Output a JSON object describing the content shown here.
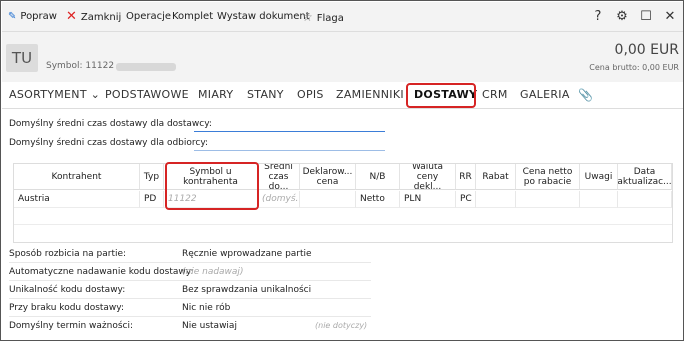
{
  "toolbar": {
    "popraw": "Popraw",
    "zamknij": "Zamknij",
    "operacje": "Operacje",
    "komplet": "Komplet",
    "wystaw": "Wystaw dokument",
    "flaga": "Flaga",
    "help": "?",
    "settings": "⚙",
    "minimize": "☐",
    "close": "✕"
  },
  "header": {
    "avatar": "TU",
    "symbol": "Symbol: 11122",
    "total": "0,00 EUR",
    "brutto": "Cena brutto: 0,00 EUR"
  },
  "tabs": [
    "ASORTYMENT ⌄",
    "PODSTAWOWE",
    "MIARY",
    "STANY",
    "OPIS",
    "ZAMIENNIKI",
    "DOSTAWY",
    "CRM",
    "GALERIA"
  ],
  "fields": {
    "avg_supplier_label": "Domyślny średni czas dostawy dla dostawcy:",
    "avg_recipient_label": "Domyślny średni czas dostawy dla odbiorcy:",
    "avg_supplier_value": "",
    "avg_recipient_value": ""
  },
  "grid": {
    "headers": [
      "Kontrahent",
      "Typ",
      "Symbol u kontrahenta",
      "Średni czas do...",
      "Deklarow... cena",
      "N/B",
      "Waluta ceny dekl...",
      "RR",
      "Rabat",
      "Cena netto po rabacie",
      "Uwagi",
      "Data aktualizac..."
    ],
    "row": [
      "Austria",
      "PD",
      "11122",
      "(domyś...",
      "",
      "Netto",
      "PLN",
      "PC",
      "",
      "",
      "",
      ""
    ]
  },
  "props": [
    {
      "label": "Sposób rozbicia na partie:",
      "value": "Ręcznie wprowadzane partie",
      "placeholder": false,
      "extra": ""
    },
    {
      "label": "Automatyczne nadawanie kodu dostawy:",
      "value": "(nie nadawaj)",
      "placeholder": true,
      "extra": ""
    },
    {
      "label": "Unikalność kodu dostawy:",
      "value": "Bez sprawdzania unikalności",
      "placeholder": false,
      "extra": ""
    },
    {
      "label": "Przy braku kodu dostawy:",
      "value": "Nic nie rób",
      "placeholder": false,
      "extra": ""
    },
    {
      "label": "Domyślny termin ważności:",
      "value": "Nie ustawiaj",
      "placeholder": false,
      "extra": "(nie dotyczy)"
    }
  ],
  "colors": {
    "highlight": "#d62424",
    "accent": "#1f6fd1",
    "close_x": "#dd2222"
  }
}
